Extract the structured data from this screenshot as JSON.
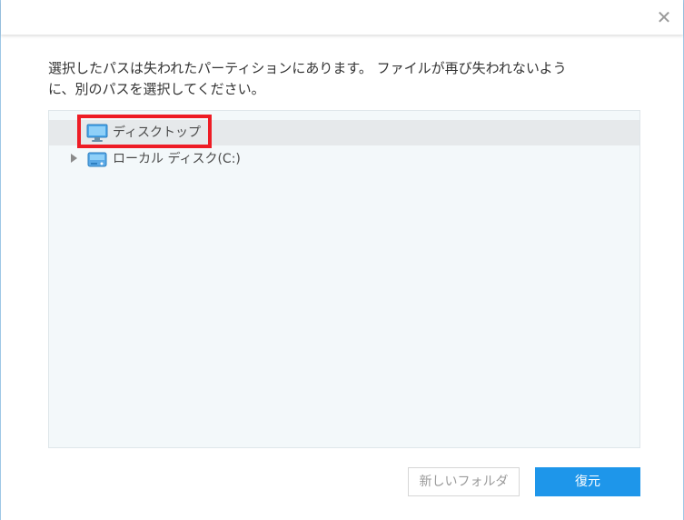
{
  "dialog": {
    "close_glyph": "✕",
    "message_line1": "選択したパスは失われたパーティションにあります。 ファイルが再び失われないよう",
    "message_line2": "に、別のパスを選択してください。"
  },
  "tree": {
    "items": [
      {
        "label": "ディスクトップ",
        "icon": "desktop-monitor-icon",
        "selected": true,
        "expandable": false
      },
      {
        "label": "ローカル ディスク(C:)",
        "icon": "local-disk-icon",
        "selected": false,
        "expandable": true
      }
    ]
  },
  "buttons": {
    "new_folder_label": "新しいフォルダ",
    "restore_label": "復元"
  },
  "colors": {
    "accent": "#1e96ea",
    "highlight": "#ee1c25",
    "panel_bg": "#f3f8fa",
    "selected_row": "#e6e9eb"
  }
}
